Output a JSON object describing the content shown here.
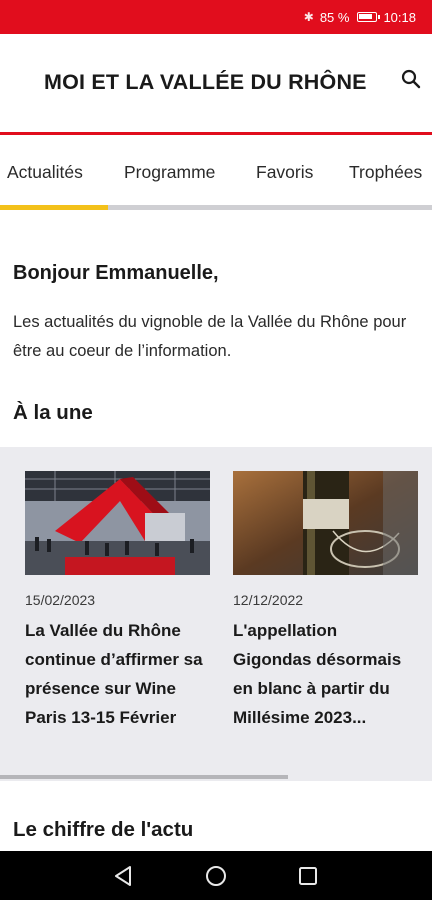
{
  "status_bar": {
    "bluetooth_icon": "bluetooth-icon",
    "battery_percent": "85 %",
    "time": "10:18"
  },
  "header": {
    "title": "MOI ET LA VALLÉE DU RHÔNE",
    "search_icon": "search-icon"
  },
  "tabs": [
    {
      "label": "Actualités",
      "active": true
    },
    {
      "label": "Programme",
      "active": false
    },
    {
      "label": "Favoris",
      "active": false
    },
    {
      "label": "Trophées",
      "active": false
    }
  ],
  "main": {
    "greeting": "Bonjour Emmanuelle,",
    "intro": "Les actualités du vignoble de la Vallée du Rhône pour être au coeur de l’information.",
    "section_une": "À la une",
    "articles": [
      {
        "date": "15/02/2023",
        "title": "La Vallée du Rhône continue d’affirmer sa présence sur Wine Paris 13-15 Février",
        "image": "trade-fair-stand-photo"
      },
      {
        "date": "12/12/2022",
        "title": "L'appellation Gigondas désormais en blanc à partir du Millésime 2023...",
        "image": "wine-bottle-glass-photo"
      }
    ],
    "section_chiffre": "Le chiffre de l'actu"
  },
  "colors": {
    "brand_red": "#e10d1d",
    "tab_indicator": "#f3c11a",
    "carousel_bg": "#ebebef"
  },
  "system_nav": {
    "back": "back-icon",
    "home": "home-icon",
    "recents": "recents-icon"
  }
}
